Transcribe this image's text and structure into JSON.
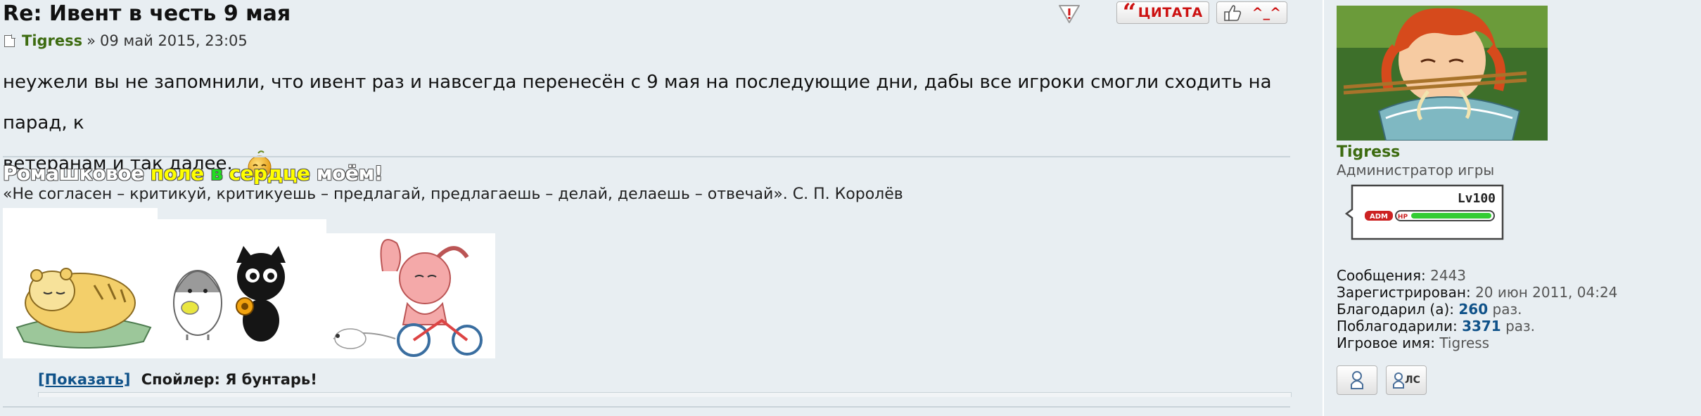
{
  "post": {
    "title": "Re: Ивент в честь 9 мая",
    "author": "Tigress",
    "separator": "»",
    "date": "09 май 2015, 23:05",
    "body_line1": "неужели вы не запомнили, что ивент раз и навсегда перенесён с 9 мая на последующие дни, дабы все игроки смогли сходить на парад, к",
    "body_line2": "ветеранам и так далее.",
    "smiley_icon": "wink-smiley-icon"
  },
  "buttons": {
    "quote_label": "ЦИТАТА",
    "thanks_label": "^_^",
    "report_icon": "report-icon",
    "thanks_icon": "thumbs-up-icon"
  },
  "signature": {
    "title_words": [
      "Ромашковое",
      "поле",
      "в",
      "сердце",
      "моём!"
    ],
    "quote": "«Не согласен – критикуй, критикуешь – предлагай, предлагаешь – делай, делаешь – отвечай». С. П. Королёв",
    "image_icons": [
      "tiger-sleeping-icon",
      "penguin-icon",
      "black-cat-icon",
      "pink-rabbit-bicycle-icon"
    ]
  },
  "spoiler": {
    "toggle_label": "[Показать]",
    "title": "Спойлер: Я бунтарь!"
  },
  "profile": {
    "username": "Tigress",
    "rank": "Администратор игры",
    "rank_badge_level": "Lv100",
    "rank_badge_tag": "ADM",
    "rank_badge_hp": "HP",
    "stats": {
      "posts_label": "Сообщения:",
      "posts_value": "2443",
      "registered_label": "Зарегистрирован:",
      "registered_value": "20 июн 2011, 04:24",
      "thanked_label": "Благодарил (а):",
      "thanked_value": "260",
      "thanked_suffix": "раз.",
      "was_thanked_label": "Поблагодарили:",
      "was_thanked_value": "3371",
      "was_thanked_suffix": "раз.",
      "game_name_label": "Игровое имя:",
      "game_name_value": "Tigress"
    },
    "pm_label": "ЛС"
  },
  "colors": {
    "background": "#e8eef2",
    "author": "#3d6b10",
    "link": "#105289",
    "quote_button_text": "#cc1111"
  }
}
